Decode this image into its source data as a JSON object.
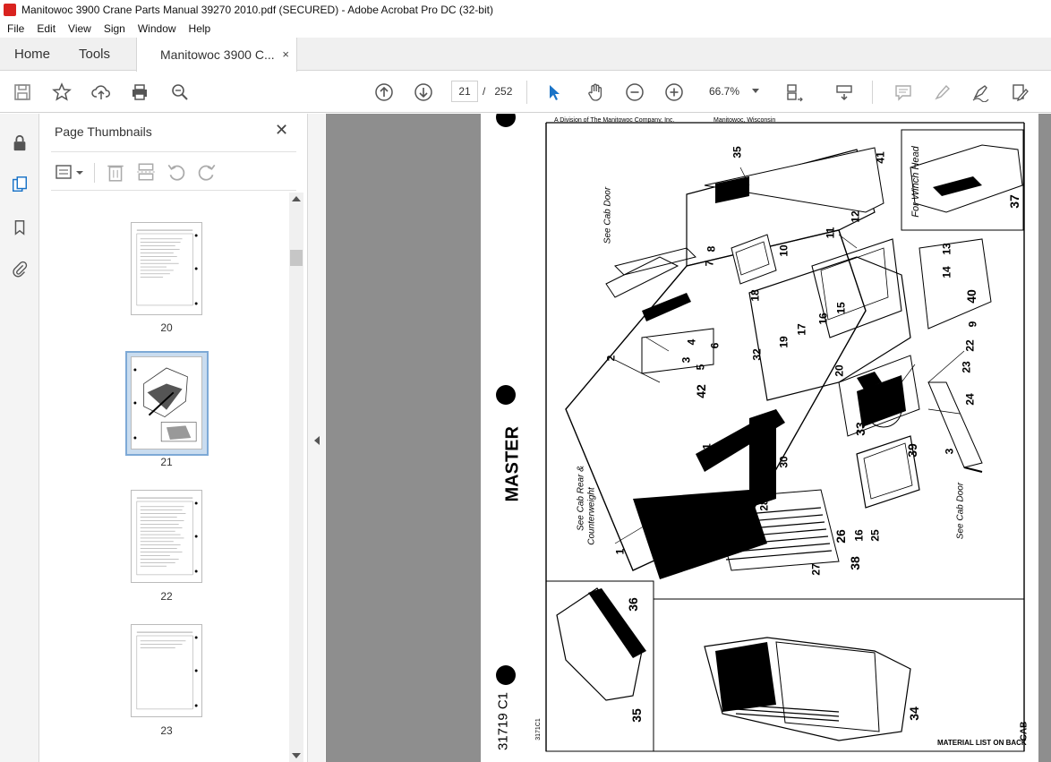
{
  "window": {
    "title": "Manitowoc 3900 Crane Parts Manual 39270 2010.pdf (SECURED) - Adobe Acrobat Pro DC (32-bit)"
  },
  "menu": [
    "File",
    "Edit",
    "View",
    "Sign",
    "Window",
    "Help"
  ],
  "tabs": {
    "home": "Home",
    "tools": "Tools",
    "document": "Manitowoc 3900 C...",
    "close": "×"
  },
  "toolbar": {
    "current_page": "21",
    "page_separator": "/",
    "total_pages": "252",
    "zoom": "66.7%"
  },
  "panel": {
    "title": "Page Thumbnails",
    "close": "✕",
    "thumbnails": [
      {
        "label": "20"
      },
      {
        "label": "21",
        "selected": true
      },
      {
        "label": "22"
      },
      {
        "label": "23"
      }
    ]
  },
  "page_content": {
    "header_left": "A Division of The Manitowoc Company, Inc.",
    "header_right": "Manitowoc, Wisconsin",
    "master": "MASTER",
    "see_cab_door_top": "See Cab Door",
    "see_cab_door_right": "See Cab Door",
    "see_cab_rear": "See Cab Rear &",
    "counterweight": "Counterweight",
    "for_winch_head": "For Winch Head",
    "material_list": "MATERIAL LIST ON BACK",
    "cab": "CAB",
    "doc_number": "3171C1",
    "handwritten": "31719 C1",
    "part_numbers": [
      "35",
      "41",
      "12",
      "11",
      "10",
      "13",
      "8",
      "7",
      "14",
      "40",
      "18",
      "16",
      "15",
      "17",
      "9",
      "32",
      "19",
      "22",
      "4",
      "6",
      "2",
      "3",
      "5",
      "23",
      "42",
      "20",
      "24",
      "33",
      "39",
      "31",
      "30",
      "3",
      "28",
      "29",
      "26",
      "16",
      "25",
      "38",
      "27",
      "1",
      "36",
      "35",
      "34",
      "37"
    ]
  }
}
